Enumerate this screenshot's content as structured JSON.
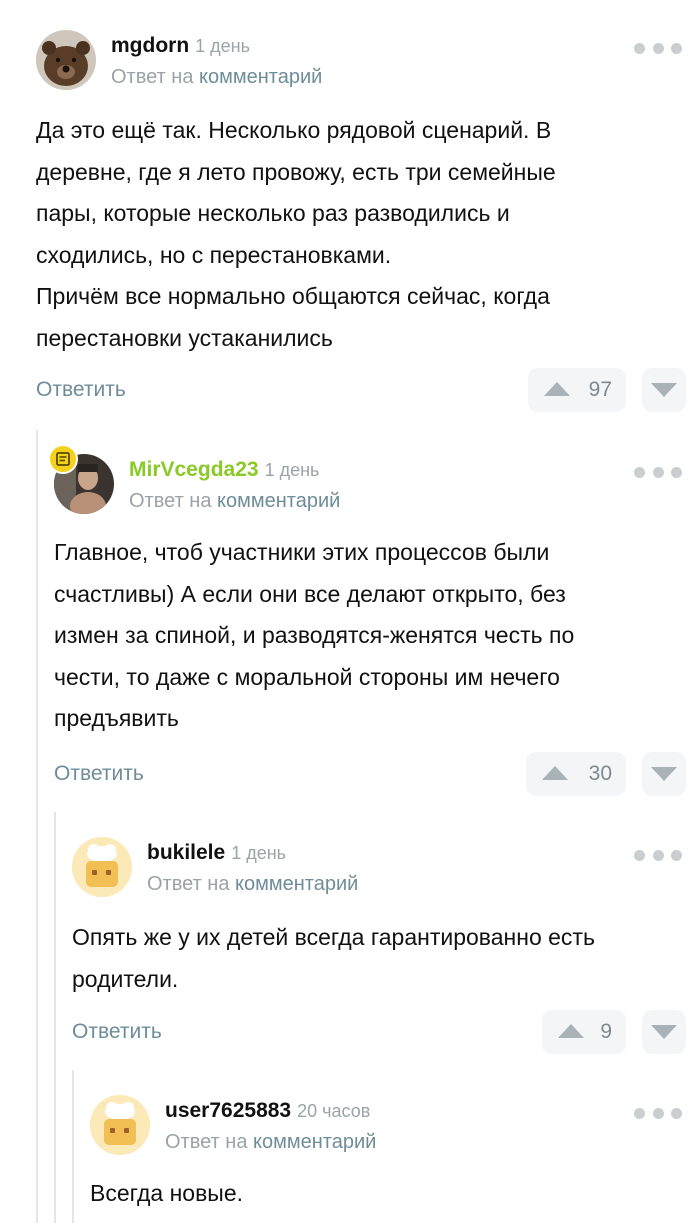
{
  "comments": [
    {
      "username": "mgdorn",
      "time": "1 день",
      "reply_prefix": "Ответ на",
      "reply_link": "комментарий",
      "lines": [
        "Да это ещё так. Несколько рядовой сценарий. В",
        "деревне, где я лето провожу, есть три семейные",
        "пары, которые несколько раз разводились и",
        "сходились, но с перестановками.",
        "Причём все нормально общаются сейчас, когда",
        "перестановки устаканились"
      ],
      "reply_label": "Ответить",
      "votes": "97"
    },
    {
      "username": "MirVcegda23",
      "time": "1 день",
      "reply_prefix": "Ответ на",
      "reply_link": "комментарий",
      "lines": [
        "Главное, чтоб участники этих процессов были",
        "счастливы) А если они все делают открыто, без",
        "измен за спиной, и разводятся-женятся честь по",
        "чести, то даже с моральной стороны им нечего",
        "предъявить"
      ],
      "reply_label": "Ответить",
      "votes": "30"
    },
    {
      "username": "bukilele",
      "time": "1 день",
      "reply_prefix": "Ответ на",
      "reply_link": "комментарий",
      "lines": [
        "Опять же у их детей всегда гарантированно есть",
        "родители."
      ],
      "reply_label": "Ответить",
      "votes": "9"
    },
    {
      "username": "user7625883",
      "time": "20 часов",
      "reply_prefix": "Ответ на",
      "reply_link": "комментарий",
      "lines": [
        "Всегда новые."
      ]
    }
  ],
  "colors": {
    "accent_link": "#6f8c99",
    "username_highlight": "#8ac926",
    "badge": "#f4d21c"
  }
}
